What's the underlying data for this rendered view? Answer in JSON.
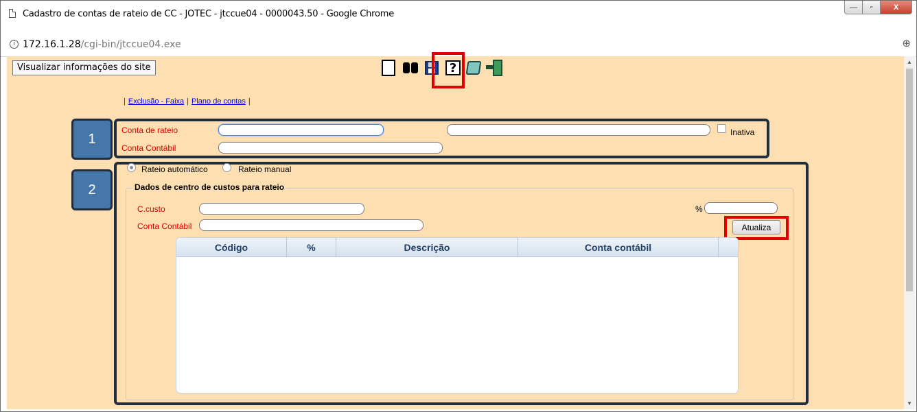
{
  "window": {
    "title": "Cadastro de contas de rateio de CC - JOTEC - jtccue04 - 0000043.50 - Google Chrome",
    "controls": {
      "minimize": "—",
      "maximize": "▫",
      "close": "X"
    }
  },
  "address": {
    "host": "172.16.1.28",
    "path": "/cgi-bin/jtccue04.exe",
    "info_symbol": "i",
    "zoom_symbol": "⊕"
  },
  "tooltip": "Visualizar informações do site",
  "toolbar": {
    "icons": [
      "new-document-icon",
      "binoculars-icon",
      "save-disk-icon",
      "help-icon",
      "notepad-icon",
      "exit-door-icon"
    ],
    "help_glyph": "?"
  },
  "links": {
    "separator": "|",
    "items": [
      "Exclusão - Faixa",
      "Plano de contas"
    ]
  },
  "badges": {
    "one": "1",
    "two": "2"
  },
  "section1": {
    "conta_rateio_label": "Conta de rateio",
    "conta_contabil_label": "Conta Contábil",
    "inativa_label": "Inativa",
    "conta_rateio_value": "",
    "descricao_value": "",
    "conta_contabil_value": "",
    "inativa_checked": false
  },
  "section2": {
    "rateio_automatico_label": "Rateio automático",
    "rateio_manual_label": "Rateio manual",
    "selected_mode": "Rateio automático",
    "legend": "Dados de centro de custos para rateio",
    "ccusto_label": "C.custo",
    "conta_contabil_label": "Conta Contábil",
    "pct_label": "%",
    "ccusto_value": "",
    "conta_contabil_value": "",
    "pct_value": "",
    "atualiza_button": "Atualiza"
  },
  "grid": {
    "columns": [
      "Código",
      "%",
      "Descrição",
      "Conta contábil"
    ],
    "rows": []
  },
  "colors": {
    "page_background": "#fddfb2",
    "label_red": "#e00000",
    "highlight_red": "#e00000",
    "badge_blue": "#4577a8",
    "box_border": "#1f2d3d",
    "grid_header_text": "#1f3f66"
  }
}
